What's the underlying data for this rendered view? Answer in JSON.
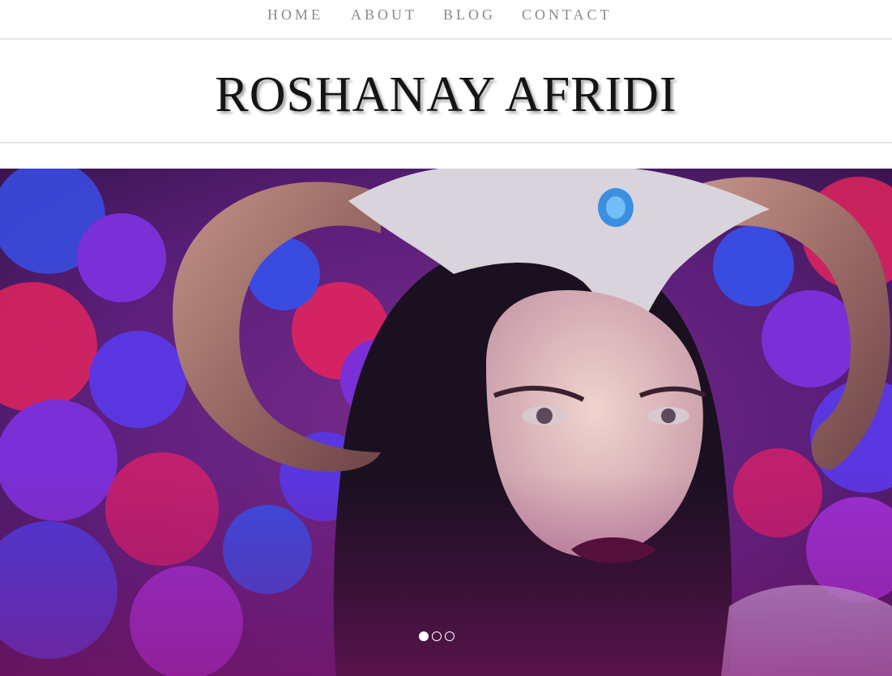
{
  "nav": {
    "items": [
      {
        "label": "HOME"
      },
      {
        "label": "ABOUT"
      },
      {
        "label": "BLOG"
      },
      {
        "label": "CONTACT"
      }
    ]
  },
  "header": {
    "site_title": "ROSHANAY AFRIDI"
  },
  "hero": {
    "slide_count": 3,
    "active_slide": 1,
    "colors": {
      "flower_purple": "#7b2fd6",
      "flower_red": "#e0245e",
      "flower_blue": "#3a4be0",
      "horn": "#a8726a",
      "hair": "#1a1020",
      "skin": "#e8c9c0",
      "lips": "#4a0f2e",
      "crown": "#d9d3dc",
      "jewel": "#3a8fe0"
    }
  }
}
